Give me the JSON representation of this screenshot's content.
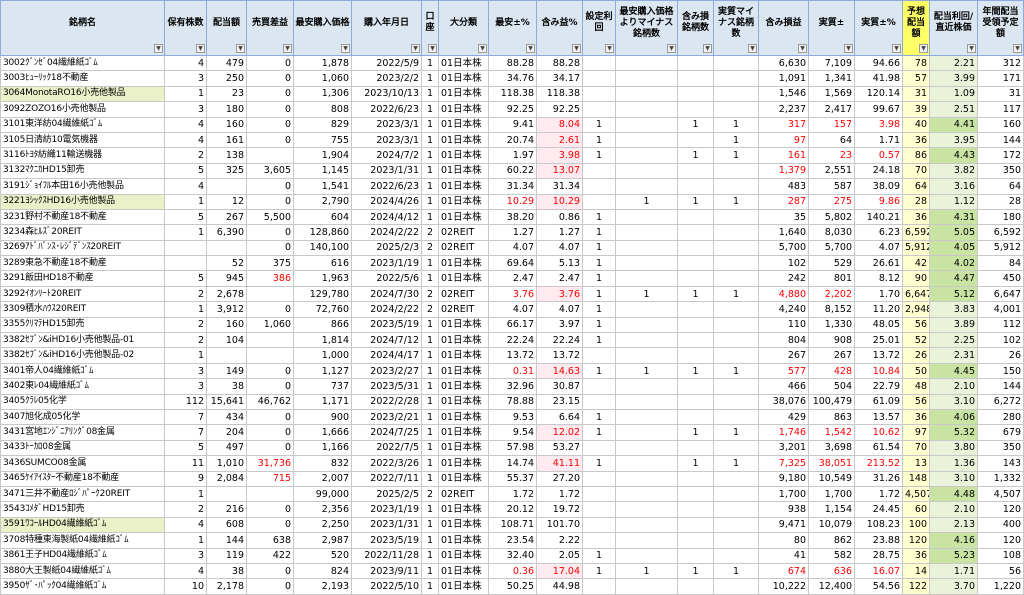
{
  "headers": [
    "銘柄名",
    "保有株数",
    "配当額",
    "売買差益",
    "最安購入価格",
    "購入年月日",
    "口座",
    "大分類",
    "最安±%",
    "含み益%",
    "設定利回",
    "最安購入価格よりマイナス銘柄数",
    "含み損銘柄数",
    "実質マイナス銘柄数",
    "含み損益",
    "実質±",
    "実質±%",
    "予想配当額",
    "配当利回/直近株価",
    "年間配当受領予定額"
  ],
  "rows": [
    [
      "3002ｸﾞﾝｾﾞ04繊維紙ｺﾞﾑ",
      "4",
      "479",
      "0",
      "1,878",
      "2022/5/9",
      "1",
      "01日本株",
      "88.28",
      "88.28",
      "",
      "",
      "",
      "",
      "6,630",
      "7,109",
      "94.66",
      "78",
      "2.21",
      "312"
    ],
    [
      "3003ﾋｭｰﾘｯｸ18不動産",
      "3",
      "250",
      "0",
      "1,060",
      "2023/2/2",
      "1",
      "01日本株",
      "34.76",
      "34.17",
      "",
      "",
      "",
      "",
      "1,091",
      "1,341",
      "41.98",
      "57",
      "3.99",
      "171"
    ],
    [
      "3064MonotaRO16小売他製品",
      "1",
      "23",
      "0",
      "1,306",
      "2023/10/13",
      "1",
      "01日本株",
      "118.38",
      "118.38",
      "",
      "",
      "",
      "",
      "1,546",
      "1,569",
      "120.14",
      "31",
      "1.09",
      "31"
    ],
    [
      "3092ZOZO16小売他製品",
      "3",
      "180",
      "0",
      "808",
      "2022/6/23",
      "1",
      "01日本株",
      "92.25",
      "92.25",
      "",
      "",
      "",
      "",
      "2,237",
      "2,417",
      "99.67",
      "39",
      "2.51",
      "117"
    ],
    [
      "3101東洋紡04繊維紙ｺﾞﾑ",
      "4",
      "160",
      "0",
      "829",
      "2023/3/1",
      "1",
      "01日本株",
      "9.41",
      "8.04",
      "1",
      "",
      "1",
      "1",
      "317",
      "157",
      "3.98",
      "40",
      "4.41",
      "160"
    ],
    [
      "3105日清紡10電気機器",
      "4",
      "161",
      "0",
      "755",
      "2023/3/1",
      "1",
      "01日本株",
      "20.74",
      "2.61",
      "1",
      "",
      "",
      "1",
      "97",
      "64",
      "1.71",
      "36",
      "3.95",
      "144"
    ],
    [
      "3116ﾄﾖﾀ紡織11輸送機器",
      "2",
      "138",
      "",
      "1,904",
      "2024/7/2",
      "1",
      "01日本株",
      "1.97",
      "3.98",
      "1",
      "",
      "1",
      "1",
      "161",
      "23",
      "0.57",
      "86",
      "4.43",
      "172"
    ],
    [
      "3132ﾏｸﾆｶHD15卸売",
      "5",
      "325",
      "3,605",
      "1,145",
      "2023/1/31",
      "1",
      "01日本株",
      "60.22",
      "13.07",
      "",
      "",
      "",
      "",
      "1,379",
      "2,551",
      "24.18",
      "70",
      "3.82",
      "350"
    ],
    [
      "3191ｼﾞｮｲﾌﾙ本田16小売他製品",
      "4",
      "",
      "0",
      "1,541",
      "2022/6/23",
      "1",
      "01日本株",
      "31.34",
      "31.34",
      "",
      "",
      "",
      "",
      "483",
      "587",
      "38.09",
      "64",
      "3.16",
      "64"
    ],
    [
      "3221ﾖｼｯｸｽHD16小売他製品",
      "1",
      "12",
      "0",
      "2,790",
      "2024/4/26",
      "1",
      "01日本株",
      "10.29",
      "10.29",
      "",
      "1",
      "1",
      "1",
      "287",
      "275",
      "9.86",
      "28",
      "1.12",
      "28"
    ],
    [
      "3231野村不動産18不動産",
      "5",
      "267",
      "5,500",
      "604",
      "2024/4/12",
      "1",
      "01日本株",
      "38.20",
      "0.86",
      "1",
      "",
      "",
      "",
      "35",
      "5,802",
      "140.21",
      "36",
      "4.31",
      "180"
    ],
    [
      "3234森ﾋﾙｽﾞ20REIT",
      "1",
      "6,390",
      "0",
      "128,860",
      "2024/2/22",
      "2",
      "02REIT",
      "1.27",
      "1.27",
      "1",
      "",
      "",
      "",
      "1,640",
      "8,030",
      "6.23",
      "6,592",
      "5.05",
      "6,592"
    ],
    [
      "3269ｱﾄﾞﾊﾞﾝｽ･ﾚｼﾞﾃﾞﾝｽ20REIT",
      "",
      "",
      "0",
      "140,100",
      "2025/2/3",
      "2",
      "02REIT",
      "4.07",
      "4.07",
      "1",
      "",
      "",
      "",
      "5,700",
      "5,700",
      "4.07",
      "5,912",
      "4.05",
      "5,912"
    ],
    [
      "3289東急不動産18不動産",
      "",
      "52",
      "375",
      "616",
      "2023/1/19",
      "1",
      "01日本株",
      "69.64",
      "5.13",
      "1",
      "",
      "",
      "",
      "102",
      "529",
      "26.61",
      "42",
      "4.02",
      "84"
    ],
    [
      "3291飯田HD18不動産",
      "5",
      "945",
      "386",
      "1,963",
      "2022/5/6",
      "1",
      "01日本株",
      "2.47",
      "2.47",
      "1",
      "",
      "",
      "",
      "242",
      "801",
      "8.12",
      "90",
      "4.47",
      "450"
    ],
    [
      "3292ｲｵﾝﾘｰﾄ20REIT",
      "2",
      "2,678",
      "",
      "129,780",
      "2024/7/30",
      "2",
      "02REIT",
      "3.76",
      "3.76",
      "1",
      "1",
      "1",
      "1",
      "4,880",
      "2,202",
      "1.70",
      "6,647",
      "5.12",
      "6,647"
    ],
    [
      "3309積水ﾊｳｽ20REIT",
      "1",
      "3,912",
      "0",
      "72,760",
      "2024/2/22",
      "2",
      "02REIT",
      "4.07",
      "4.07",
      "1",
      "",
      "",
      "",
      "4,240",
      "8,152",
      "11.20",
      "2,948",
      "3.83",
      "4,001"
    ],
    [
      "3355ｸﾘﾏﾃHD15卸売",
      "2",
      "160",
      "1,060",
      "866",
      "2023/5/19",
      "1",
      "01日本株",
      "66.17",
      "3.97",
      "1",
      "",
      "",
      "",
      "110",
      "1,330",
      "48.05",
      "56",
      "3.89",
      "112"
    ],
    [
      "3382ｾﾌﾞﾝ&iHD16小売他製品-01",
      "2",
      "104",
      "",
      "1,814",
      "2024/7/12",
      "1",
      "01日本株",
      "22.24",
      "22.24",
      "1",
      "",
      "",
      "",
      "804",
      "908",
      "25.01",
      "52",
      "2.25",
      "102"
    ],
    [
      "3382ｾﾌﾞﾝ&iHD16小売他製品-02",
      "1",
      "",
      "",
      "1,000",
      "2024/4/17",
      "1",
      "01日本株",
      "13.72",
      "13.72",
      "",
      "",
      "",
      "",
      "267",
      "267",
      "13.72",
      "26",
      "2.31",
      "26"
    ],
    [
      "3401帝人04繊維紙ｺﾞﾑ",
      "3",
      "149",
      "0",
      "1,127",
      "2023/2/27",
      "1",
      "01日本株",
      "0.31",
      "14.63",
      "1",
      "1",
      "1",
      "1",
      "577",
      "428",
      "10.84",
      "50",
      "4.45",
      "150"
    ],
    [
      "3402東ﾚ04繊維紙ｺﾞﾑ",
      "3",
      "38",
      "0",
      "737",
      "2023/5/31",
      "1",
      "01日本株",
      "32.96",
      "30.87",
      "",
      "",
      "",
      "",
      "466",
      "504",
      "22.79",
      "48",
      "2.10",
      "144"
    ],
    [
      "3405ｸﾗﾚ05化学",
      "112",
      "15,641",
      "46,762",
      "1,171",
      "2022/2/28",
      "1",
      "01日本株",
      "78.88",
      "23.15",
      "",
      "",
      "",
      "",
      "38,076",
      "100,479",
      "61.09",
      "56",
      "3.10",
      "6,272"
    ],
    [
      "3407旭化成05化学",
      "7",
      "434",
      "0",
      "900",
      "2023/2/21",
      "1",
      "01日本株",
      "9.53",
      "6.64",
      "1",
      "",
      "",
      "",
      "429",
      "863",
      "13.57",
      "36",
      "4.06",
      "280"
    ],
    [
      "3431宮地ｴﾝｼﾞﾆｱﾘﾝｸﾞ08金属",
      "7",
      "204",
      "0",
      "1,666",
      "2024/7/25",
      "1",
      "01日本株",
      "9.54",
      "12.02",
      "1",
      "",
      "1",
      "1",
      "1,746",
      "1,542",
      "10.62",
      "97",
      "5.32",
      "679"
    ],
    [
      "3433ﾄｰｶﾛ08金属",
      "5",
      "497",
      "0",
      "1,166",
      "2022/7/5",
      "1",
      "01日本株",
      "57.98",
      "53.27",
      "",
      "",
      "",
      "",
      "3,201",
      "3,698",
      "61.54",
      "70",
      "3.80",
      "350"
    ],
    [
      "3436SUMCO08金属",
      "11",
      "1,010",
      "31,736",
      "832",
      "2022/3/26",
      "1",
      "01日本株",
      "14.74",
      "41.11",
      "1",
      "",
      "1",
      "1",
      "7,325",
      "38,051",
      "213.52",
      "13",
      "1.36",
      "143"
    ],
    [
      "3465ｹｲｱｲｽﾀｰ不動産18不動産",
      "9",
      "2,084",
      "715",
      "2,007",
      "2022/7/11",
      "1",
      "01日本株",
      "55.37",
      "27.20",
      "",
      "",
      "",
      "",
      "9,180",
      "10,549",
      "31.26",
      "148",
      "3.10",
      "1,332"
    ],
    [
      "3471三井不動産ﾛｼﾞﾊﾟｰｸ20REIT",
      "1",
      "",
      "",
      "99,000",
      "2025/2/5",
      "2",
      "02REIT",
      "1.72",
      "1.72",
      "",
      "",
      "",
      "",
      "1,700",
      "1,700",
      "1.72",
      "4,507",
      "4.48",
      "4,507"
    ],
    [
      "3543ｺﾒﾀﾞHD15卸売",
      "2",
      "216",
      "0",
      "2,356",
      "2023/1/19",
      "1",
      "01日本株",
      "20.12",
      "19.72",
      "",
      "",
      "",
      "",
      "938",
      "1,154",
      "24.45",
      "60",
      "2.10",
      "120"
    ],
    [
      "3591ﾜｺｰﾙHD04繊維紙ｺﾞﾑ",
      "4",
      "608",
      "0",
      "2,250",
      "2023/1/31",
      "1",
      "01日本株",
      "108.71",
      "101.70",
      "",
      "",
      "",
      "",
      "9,471",
      "10,079",
      "108.23",
      "100",
      "2.13",
      "400"
    ],
    [
      "3708特種東海製紙04繊維紙ｺﾞﾑ",
      "1",
      "144",
      "638",
      "2,987",
      "2023/5/19",
      "1",
      "01日本株",
      "23.54",
      "2.22",
      "",
      "",
      "",
      "",
      "80",
      "862",
      "23.88",
      "120",
      "4.16",
      "120"
    ],
    [
      "3861王子HD04繊維紙ｺﾞﾑ",
      "3",
      "119",
      "422",
      "520",
      "2022/11/28",
      "1",
      "01日本株",
      "32.40",
      "2.05",
      "1",
      "",
      "",
      "",
      "41",
      "582",
      "28.75",
      "36",
      "5.23",
      "108"
    ],
    [
      "3880大王製紙04繊維紙ｺﾞﾑ",
      "4",
      "38",
      "0",
      "824",
      "2023/9/11",
      "1",
      "01日本株",
      "0.36",
      "17.04",
      "1",
      "1",
      "1",
      "1",
      "674",
      "636",
      "16.07",
      "14",
      "1.71",
      "56"
    ],
    [
      "3950ｻﾞ･ﾊﾟｯｸ04繊維紙ｺﾞﾑ",
      "10",
      "2,178",
      "0",
      "2,193",
      "2022/5/10",
      "1",
      "01日本株",
      "50.25",
      "44.98",
      "",
      "",
      "",
      "",
      "10,222",
      "12,400",
      "54.56",
      "122",
      "3.70",
      "1,220"
    ]
  ],
  "highlighted_rows": [
    2,
    9,
    30
  ],
  "negative_cells": [
    [
      4,
      9
    ],
    [
      4,
      14
    ],
    [
      4,
      15
    ],
    [
      4,
      16
    ],
    [
      5,
      9
    ],
    [
      5,
      14
    ],
    [
      6,
      9
    ],
    [
      6,
      14
    ],
    [
      6,
      15
    ],
    [
      6,
      16
    ],
    [
      7,
      9
    ],
    [
      7,
      14
    ],
    [
      9,
      8
    ],
    [
      9,
      9
    ],
    [
      9,
      14
    ],
    [
      9,
      15
    ],
    [
      9,
      16
    ],
    [
      14,
      3
    ],
    [
      15,
      8
    ],
    [
      15,
      9
    ],
    [
      15,
      14
    ],
    [
      15,
      15
    ],
    [
      20,
      8
    ],
    [
      20,
      9
    ],
    [
      20,
      14
    ],
    [
      20,
      15
    ],
    [
      20,
      16
    ],
    [
      24,
      9
    ],
    [
      24,
      14
    ],
    [
      24,
      15
    ],
    [
      24,
      16
    ],
    [
      26,
      3
    ],
    [
      26,
      9
    ],
    [
      26,
      14
    ],
    [
      26,
      15
    ],
    [
      26,
      16
    ],
    [
      27,
      3
    ],
    [
      33,
      8
    ],
    [
      33,
      9
    ],
    [
      33,
      14
    ],
    [
      33,
      15
    ],
    [
      33,
      16
    ]
  ],
  "colors": {
    "header_bg": "#dce6f1",
    "header_highlight": "#ffff66",
    "negative_text": "#ff0000",
    "row_highlight": "#eaf0c8",
    "yield_highlight": "#c9e3a3"
  }
}
